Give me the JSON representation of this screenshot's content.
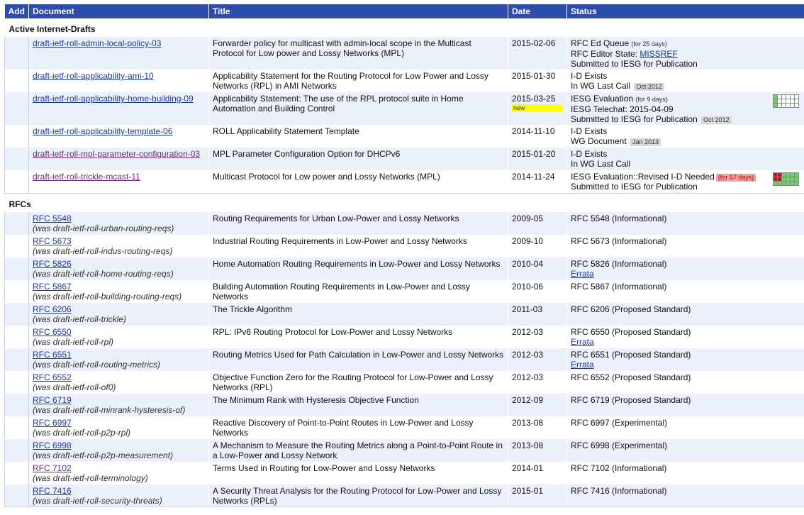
{
  "headers": {
    "add": "Add",
    "document": "Document",
    "title": "Title",
    "date": "Date",
    "status": "Status"
  },
  "groups": [
    {
      "label": "Active Internet-Drafts",
      "rows": [
        {
          "doc": "draft-ietf-roll-admin-local-policy-03",
          "title": "Forwarder policy for multicast with admin-local scope in the Multicast Protocol for Low power and Lossy Networks (MPL)",
          "date": "2015-02-06",
          "status": [
            {
              "text": "RFC Ed Queue",
              "small": "(for 25 days)"
            },
            {
              "text": "RFC Editor State: ",
              "link": "MISSREF"
            },
            {
              "text": "Submitted to IESG for Publication"
            }
          ]
        },
        {
          "doc": "draft-ietf-roll-applicability-ami-10",
          "title": "Applicability Statement for the Routing Protocol for Low Power and Lossy Networks (RPL) in AMI Networks",
          "date": "2015-01-30",
          "status": [
            {
              "text": "I-D Exists"
            },
            {
              "text": "In WG Last Call",
              "badge": "Oct 2012"
            }
          ]
        },
        {
          "doc": "draft-ietf-roll-applicability-home-building-09",
          "title": "Applicability Statement: The use of the RPL protocol suite in Home Automation and Building Control",
          "date": "2015-03-25",
          "date_tag": "new",
          "status": [
            {
              "text": "IESG Evaluation",
              "small": "(for 9 days)"
            },
            {
              "text": "IESG Telechat: 2015-04-09"
            },
            {
              "text": "Submitted to IESG for Publication",
              "badge": "Oct 2012"
            }
          ],
          "ballot": "none"
        },
        {
          "doc": "draft-ietf-roll-applicability-template-06",
          "title": "ROLL Applicability Statement Template",
          "date": "2014-11-10",
          "status": [
            {
              "text": "I-D Exists"
            },
            {
              "text": "WG Document",
              "badge": "Jan 2013"
            }
          ]
        },
        {
          "doc": "draft-ietf-roll-mpl-parameter-configuration-03",
          "title": "MPL Parameter Configuration Option for DHCPv6",
          "date": "2015-01-20",
          "status": [
            {
              "text": "I-D Exists"
            },
            {
              "text": "In WG Last Call"
            }
          ]
        },
        {
          "doc": "draft-ietf-roll-trickle-mcast-11",
          "title": "Multicast Protocol for Low power and Lossy Networks (MPL)",
          "date": "2014-11-24",
          "status": [
            {
              "text": "IESG Evaluation::Revised I-D Needed",
              "red_badge": "(for 57 days)"
            },
            {
              "text": "Submitted to IESG for Publication"
            }
          ],
          "ballot": "votes"
        }
      ]
    },
    {
      "label": "RFCs",
      "rows": [
        {
          "doc": "RFC 5548",
          "was": "(was draft-ietf-roll-urban-routing-reqs)",
          "title": "Routing Requirements for Urban Low-Power and Lossy Networks",
          "date": "2009-05",
          "status": [
            {
              "text": "RFC 5548 (Informational)"
            }
          ]
        },
        {
          "doc": "RFC 5673",
          "was": "(was draft-ietf-roll-indus-routing-reqs)",
          "title": "Industrial Routing Requirements in Low-Power and Lossy Networks",
          "date": "2009-10",
          "status": [
            {
              "text": "RFC 5673 (Informational)"
            }
          ]
        },
        {
          "doc": "RFC 5826",
          "was": "(was draft-ietf-roll-home-routing-reqs)",
          "title": "Home Automation Routing Requirements in Low-Power and Lossy Networks",
          "date": "2010-04",
          "status": [
            {
              "text": "RFC 5826 (Informational)"
            },
            {
              "errata": "Errata"
            }
          ]
        },
        {
          "doc": "RFC 5867",
          "was": "(was draft-ietf-roll-building-routing-reqs)",
          "title": "Building Automation Routing Requirements in Low-Power and Lossy Networks",
          "date": "2010-06",
          "status": [
            {
              "text": "RFC 5867 (Informational)"
            }
          ]
        },
        {
          "doc": "RFC 6206",
          "was": "(was draft-ietf-roll-trickle)",
          "title": "The Trickle Algorithm",
          "date": "2011-03",
          "status": [
            {
              "text": "RFC 6206 (Proposed Standard)"
            }
          ]
        },
        {
          "doc": "RFC 6550",
          "was": "(was draft-ietf-roll-rpl)",
          "title": "RPL: IPv6 Routing Protocol for Low-Power and Lossy Networks",
          "date": "2012-03",
          "status": [
            {
              "text": "RFC 6550 (Proposed Standard)"
            },
            {
              "errata": "Errata"
            }
          ]
        },
        {
          "doc": "RFC 6551",
          "was": "(was draft-ietf-roll-routing-metrics)",
          "title": "Routing Metrics Used for Path Calculation in Low-Power and Lossy Networks",
          "date": "2012-03",
          "status": [
            {
              "text": "RFC 6551 (Proposed Standard)"
            },
            {
              "errata": "Errata"
            }
          ]
        },
        {
          "doc": "RFC 6552",
          "was": "(was draft-ietf-roll-of0)",
          "title": "Objective Function Zero for the Routing Protocol for Low-Power and Lossy Networks (RPL)",
          "date": "2012-03",
          "status": [
            {
              "text": "RFC 6552 (Proposed Standard)"
            }
          ]
        },
        {
          "doc": "RFC 6719",
          "was": "(was draft-ietf-roll-minrank-hysteresis-of)",
          "title": "The Minimum Rank with Hysteresis Objective Function",
          "date": "2012-09",
          "status": [
            {
              "text": "RFC 6719 (Proposed Standard)"
            }
          ]
        },
        {
          "doc": "RFC 6997",
          "was": "(was draft-ietf-roll-p2p-rpl)",
          "title": "Reactive Discovery of Point-to-Point Routes in Low-Power and Lossy Networks",
          "date": "2013-08",
          "status": [
            {
              "text": "RFC 6997 (Experimental)"
            }
          ]
        },
        {
          "doc": "RFC 6998",
          "was": "(was draft-ietf-roll-p2p-measurement)",
          "title": "A Mechanism to Measure the Routing Metrics along a Point-to-Point Route in a Low-Power and Lossy Network",
          "date": "2013-08",
          "status": [
            {
              "text": "RFC 6998 (Experimental)"
            }
          ]
        },
        {
          "doc": "RFC 7102",
          "was": "(was draft-ietf-roll-terminology)",
          "title": "Terms Used in Routing for Low-Power and Lossy Networks",
          "date": "2014-01",
          "status": [
            {
              "text": "RFC 7102 (Informational)"
            }
          ]
        },
        {
          "doc": "RFC 7416",
          "was": "(was draft-ietf-roll-security-threats)",
          "title": "A Security Threat Analysis for the Routing Protocol for Low-Power and Lossy Networks (RPLs)",
          "date": "2015-01",
          "status": [
            {
              "text": "RFC 7416 (Informational)"
            }
          ]
        }
      ]
    }
  ],
  "colors": {
    "header_bg": "#2f4bab",
    "row_alt": "#eaf1fa",
    "link": "#1b3aa0",
    "new_tag": "#ffff00",
    "late_badge": "#f2a0a0"
  }
}
